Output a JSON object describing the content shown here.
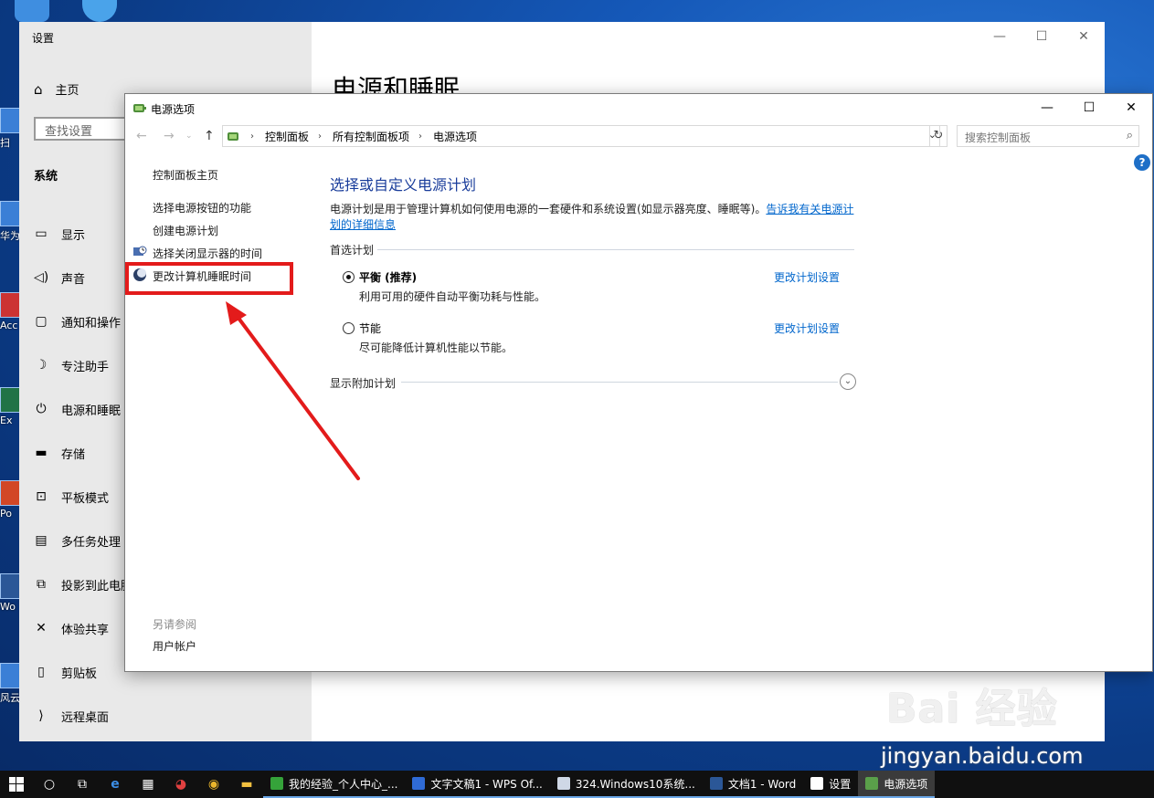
{
  "settings": {
    "title": "设置",
    "home": "主页",
    "search_placeholder": "查找设置",
    "section": "系统",
    "nav": [
      {
        "icon": "display-icon",
        "glyph": "▭",
        "label": "显示"
      },
      {
        "icon": "sound-icon",
        "glyph": "◁)",
        "label": "声音"
      },
      {
        "icon": "notification-icon",
        "glyph": "▢",
        "label": "通知和操作"
      },
      {
        "icon": "focus-assist-icon",
        "glyph": "☽",
        "label": "专注助手"
      },
      {
        "icon": "power-icon",
        "glyph": "⏻",
        "label": "电源和睡眠"
      },
      {
        "icon": "storage-icon",
        "glyph": "▬",
        "label": "存储"
      },
      {
        "icon": "tablet-mode-icon",
        "glyph": "⊡",
        "label": "平板模式"
      },
      {
        "icon": "multitasking-icon",
        "glyph": "▤",
        "label": "多任务处理"
      },
      {
        "icon": "project-icon",
        "glyph": "⧉",
        "label": "投影到此电脑"
      },
      {
        "icon": "shared-experiences-icon",
        "glyph": "✕",
        "label": "体验共享"
      },
      {
        "icon": "clipboard-icon",
        "glyph": "▯",
        "label": "剪贴板"
      },
      {
        "icon": "remote-desktop-icon",
        "glyph": "⟩",
        "label": "远程桌面"
      }
    ],
    "main_title": "电源和睡眠"
  },
  "cp": {
    "title": "电源选项",
    "breadcrumbs": [
      "控制面板",
      "所有控制面板项",
      "电源选项"
    ],
    "search_placeholder": "搜索控制面板",
    "sidebar": {
      "home": "控制面板主页",
      "links": [
        "选择电源按钮的功能",
        "创建电源计划",
        "选择关闭显示器的时间",
        "更改计算机睡眠时间"
      ]
    },
    "heading": "选择或自定义电源计划",
    "description": "电源计划是用于管理计算机如何使用电源的一套硬件和系统设置(如显示器亮度、睡眠等)。",
    "description_link": "告诉我有关电源计划的详细信息",
    "preferred_header": "首选计划",
    "plans": [
      {
        "name": "平衡 (推荐)",
        "desc": "利用可用的硬件自动平衡功耗与性能。",
        "selected": true,
        "change": "更改计划设置"
      },
      {
        "name": "节能",
        "desc": "尽可能降低计算机性能以节能。",
        "selected": false,
        "change": "更改计划设置"
      }
    ],
    "show_more": "显示附加计划",
    "see_also": "另请参阅",
    "user_accounts": "用户帐户"
  },
  "desktop_labels": [
    "扫",
    "华为",
    "Acc",
    "Ex",
    "Po",
    "Wo",
    "风云"
  ],
  "watermark": {
    "logo": "Bai 经验",
    "url": "jingyan.baidu.com"
  },
  "taskbar": {
    "apps": [
      {
        "label": "我的经验_个人中心_...",
        "color": "#35a33a"
      },
      {
        "label": "文字文稿1 - WPS Of...",
        "color": "#2f6bd6"
      },
      {
        "label": "324.Windows10系统...",
        "color": "#cfd8e6"
      },
      {
        "label": "文档1 - Word",
        "color": "#2b5797"
      },
      {
        "label": "设置",
        "color": "#ffffff"
      },
      {
        "label": "电源选项",
        "color": "#5aa04a"
      }
    ]
  },
  "colors": {
    "accent_link": "#0066cc",
    "heading_blue": "#1a3d9b",
    "highlight_red": "#e31b1b"
  }
}
